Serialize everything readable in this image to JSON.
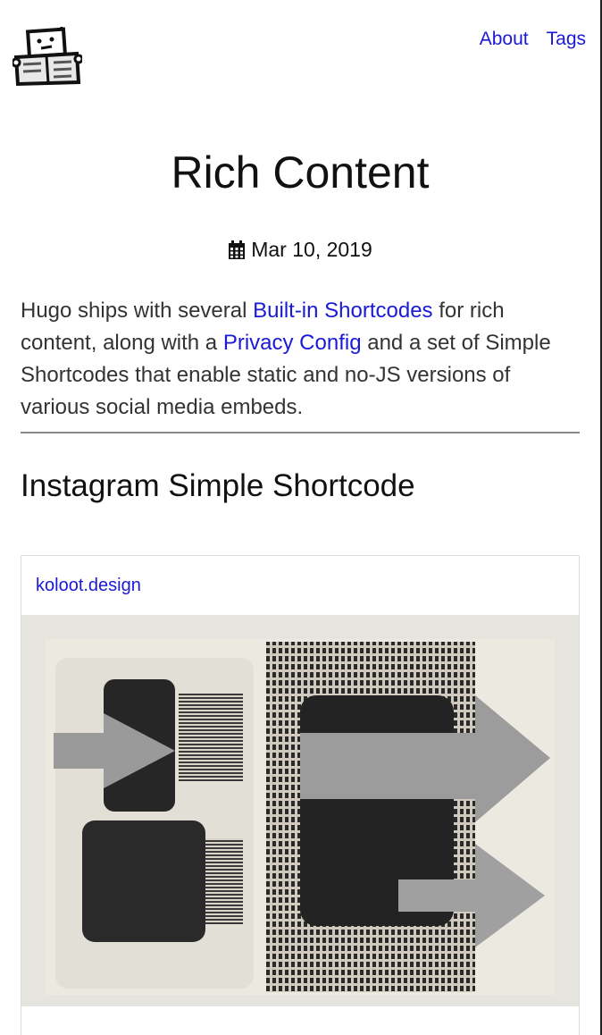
{
  "header": {
    "logo_icon": "robot-newspaper-logo",
    "nav": [
      {
        "label": "About"
      },
      {
        "label": "Tags"
      }
    ]
  },
  "post": {
    "title": "Rich Content",
    "date_icon": "calendar-icon",
    "date": "Mar 10, 2019",
    "intro": {
      "part1": "Hugo ships with several ",
      "link1": "Built-in Shortcodes",
      "part2": " for rich content, along with a ",
      "link2": "Privacy Config",
      "part3": " and a set of Simple Shortcodes that enable static and no-JS versions of various social media embeds."
    },
    "section_heading": "Instagram Simple Shortcode",
    "instagram": {
      "username": "koloot.design"
    }
  },
  "colors": {
    "link": "#1a1ad6",
    "text": "#333333",
    "heading": "#111111",
    "rule": "#888888"
  }
}
